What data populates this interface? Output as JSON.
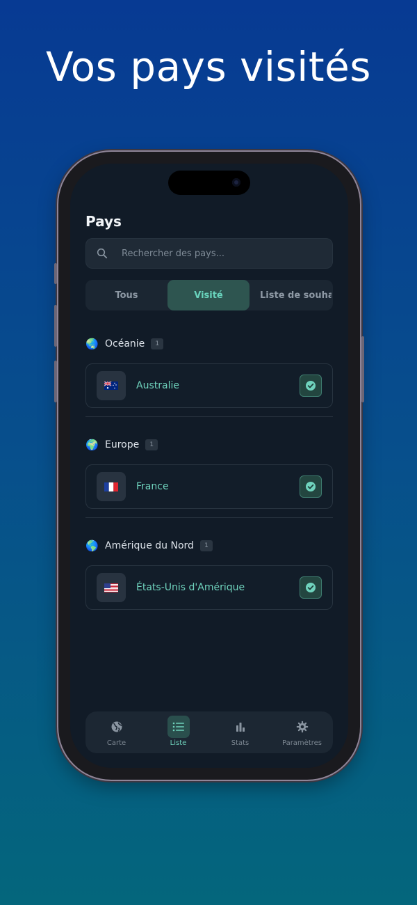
{
  "headline": "Vos pays visités",
  "app": {
    "title": "Pays",
    "search": {
      "placeholder": "Rechercher des pays...",
      "value": ""
    },
    "filters": [
      {
        "label": "Tous",
        "active": false
      },
      {
        "label": "Visité",
        "active": true
      },
      {
        "label": "Liste de souhaits",
        "active": false
      }
    ],
    "sections": [
      {
        "name": "Océanie",
        "count": "1",
        "countries": [
          {
            "name": "Australie",
            "flag": "australia-flag-icon",
            "visited": true
          }
        ]
      },
      {
        "name": "Europe",
        "count": "1",
        "countries": [
          {
            "name": "France",
            "flag": "france-flag-icon",
            "visited": true
          }
        ]
      },
      {
        "name": "Amérique du Nord",
        "count": "1",
        "countries": [
          {
            "name": "États-Unis d'Amérique",
            "flag": "usa-flag-icon",
            "visited": true
          }
        ]
      }
    ],
    "tabs": [
      {
        "label": "Carte",
        "icon": "globe-icon",
        "active": false
      },
      {
        "label": "Liste",
        "icon": "list-icon",
        "active": true
      },
      {
        "label": "Stats",
        "icon": "bar-chart-icon",
        "active": false
      },
      {
        "label": "Paramètres",
        "icon": "gear-icon",
        "active": false
      }
    ]
  },
  "colors": {
    "accent": "#6fd3bd",
    "background": "#111b27",
    "active_segment": "#2e5550"
  }
}
